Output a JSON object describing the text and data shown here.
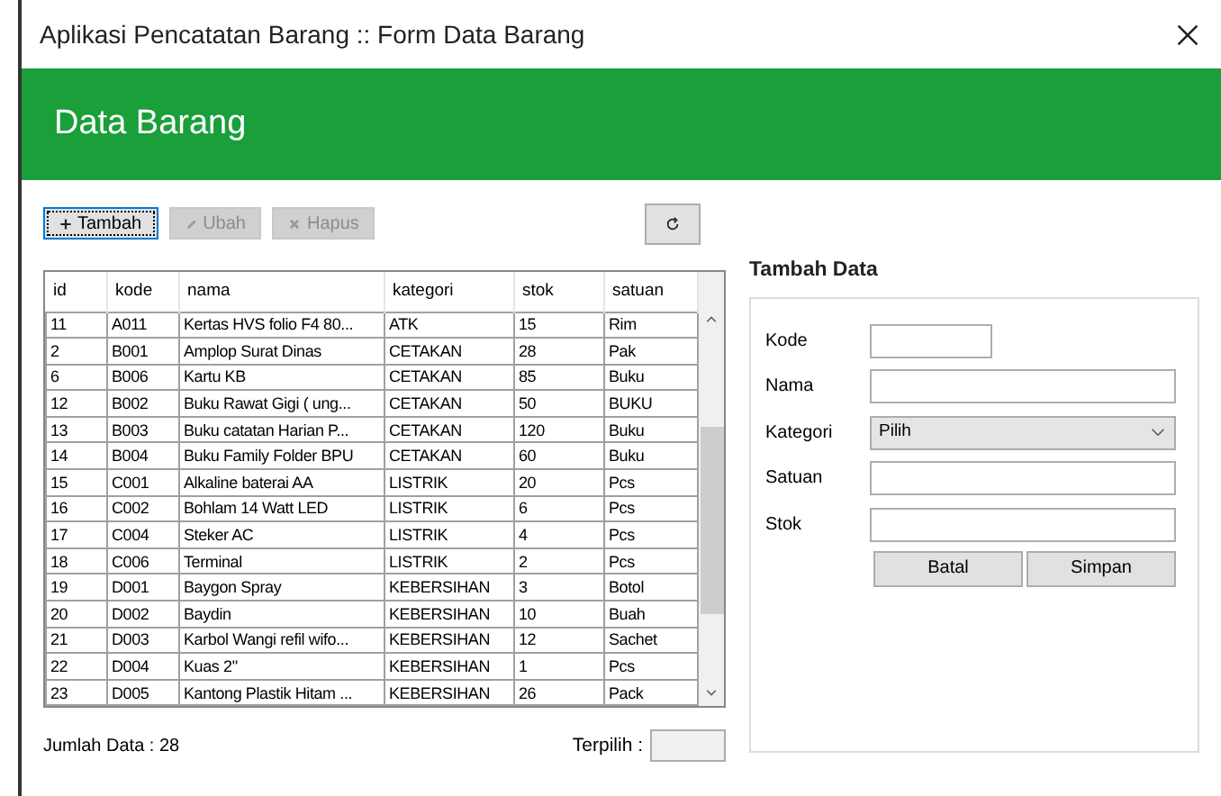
{
  "window": {
    "title": "Aplikasi Pencatatan Barang :: Form Data Barang"
  },
  "header": {
    "title": "Data Barang"
  },
  "toolbar": [
    {
      "label": "Tambah",
      "kind": "add",
      "disabled": false,
      "focused": true
    },
    {
      "label": "Ubah",
      "kind": "edit",
      "disabled": true,
      "focused": false
    },
    {
      "label": "Hapus",
      "kind": "delete",
      "disabled": true,
      "focused": false
    },
    {
      "kind": "refresh",
      "disabled": false,
      "focused": false
    }
  ],
  "table": {
    "columns": [
      "id",
      "kode",
      "nama",
      "kategori",
      "stok",
      "satuan"
    ],
    "rows": [
      [
        "11",
        "A011",
        "Kertas HVS folio F4 80...",
        "ATK",
        "15",
        "Rim"
      ],
      [
        "2",
        "B001",
        "Amplop Surat Dinas",
        "CETAKAN",
        "28",
        "Pak"
      ],
      [
        "6",
        "B006",
        "Kartu KB",
        "CETAKAN",
        "85",
        "Buku"
      ],
      [
        "12",
        "B002",
        "Buku Rawat Gigi ( ung...",
        "CETAKAN",
        "50",
        "BUKU"
      ],
      [
        "13",
        "B003",
        "Buku catatan Harian P...",
        "CETAKAN",
        "120",
        "Buku"
      ],
      [
        "14",
        "B004",
        "Buku Family Folder BPU",
        "CETAKAN",
        "60",
        "Buku"
      ],
      [
        "15",
        "C001",
        "Alkaline baterai AA",
        "LISTRIK",
        "20",
        "Pcs"
      ],
      [
        "16",
        "C002",
        "Bohlam 14 Watt LED",
        "LISTRIK",
        "6",
        "Pcs"
      ],
      [
        "17",
        "C004",
        "Steker AC",
        "LISTRIK",
        "4",
        "Pcs"
      ],
      [
        "18",
        "C006",
        "Terminal",
        "LISTRIK",
        "2",
        "Pcs"
      ],
      [
        "19",
        "D001",
        "Baygon Spray",
        "KEBERSIHAN",
        "3",
        "Botol"
      ],
      [
        "20",
        "D002",
        "Baydin",
        "KEBERSIHAN",
        "10",
        "Buah"
      ],
      [
        "21",
        "D003",
        "Karbol Wangi refil wifo...",
        "KEBERSIHAN",
        "12",
        "Sachet"
      ],
      [
        "22",
        "D004",
        "Kuas 2\"",
        "KEBERSIHAN",
        "1",
        "Pcs"
      ],
      [
        "23",
        "D005",
        "Kantong Plastik Hitam ...",
        "KEBERSIHAN",
        "26",
        "Pack"
      ]
    ]
  },
  "footer": {
    "count": "Jumlah Data : 28",
    "selected_label": "Terpilih :"
  },
  "form": {
    "title": "Tambah Data",
    "fields": [
      {
        "label": "Kode",
        "kind": "short"
      },
      {
        "label": "Nama",
        "kind": "text"
      },
      {
        "label": "Kategori",
        "kind": "select",
        "value": "Pilih"
      },
      {
        "label": "Satuan",
        "kind": "text"
      },
      {
        "label": "Stok",
        "kind": "text"
      }
    ],
    "buttons": [
      "Batal",
      "Simpan"
    ]
  }
}
